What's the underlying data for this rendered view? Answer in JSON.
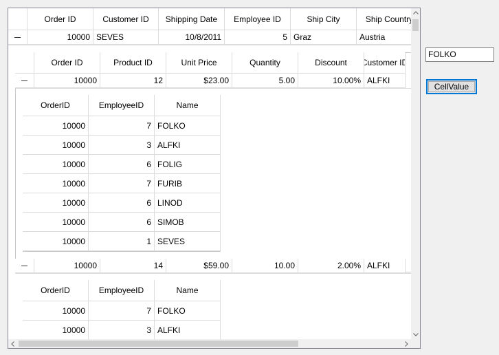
{
  "textbox": {
    "value": "FOLKO"
  },
  "button": {
    "label": "CellValue"
  },
  "main_grid": {
    "columns": [
      "Order ID",
      "Customer ID",
      "Shipping Date",
      "Employee ID",
      "Ship City",
      "Ship Country"
    ],
    "row": [
      "10000",
      "SEVES",
      "10/8/2011",
      "5",
      "Graz",
      "Austria"
    ]
  },
  "detail_grid": {
    "columns": [
      "Order ID",
      "Product ID",
      "Unit Price",
      "Quantity",
      "Discount",
      "Customer ID"
    ],
    "rows": [
      [
        "10000",
        "12",
        "$23.00",
        "5.00",
        "10.00%",
        "ALFKI"
      ],
      [
        "10000",
        "14",
        "$59.00",
        "10.00",
        "2.00%",
        "ALFKI"
      ]
    ]
  },
  "nested_grids": [
    {
      "columns": [
        "OrderID",
        "EmployeeID",
        "Name"
      ],
      "rows": [
        [
          "10000",
          "7",
          "FOLKO"
        ],
        [
          "10000",
          "3",
          "ALFKI"
        ],
        [
          "10000",
          "6",
          "FOLIG"
        ],
        [
          "10000",
          "7",
          "FURIB"
        ],
        [
          "10000",
          "6",
          "LINOD"
        ],
        [
          "10000",
          "6",
          "SIMOB"
        ],
        [
          "10000",
          "1",
          "SEVES"
        ]
      ]
    },
    {
      "columns": [
        "OrderID",
        "EmployeeID",
        "Name"
      ],
      "rows": [
        [
          "10000",
          "7",
          "FOLKO"
        ],
        [
          "10000",
          "3",
          "ALFKI"
        ]
      ]
    }
  ],
  "icons": {
    "collapse": "minus-icon",
    "scroll_up": "chevron-up-icon",
    "scroll_down": "chevron-down-icon",
    "scroll_left": "chevron-left-icon",
    "scroll_right": "chevron-right-icon"
  }
}
